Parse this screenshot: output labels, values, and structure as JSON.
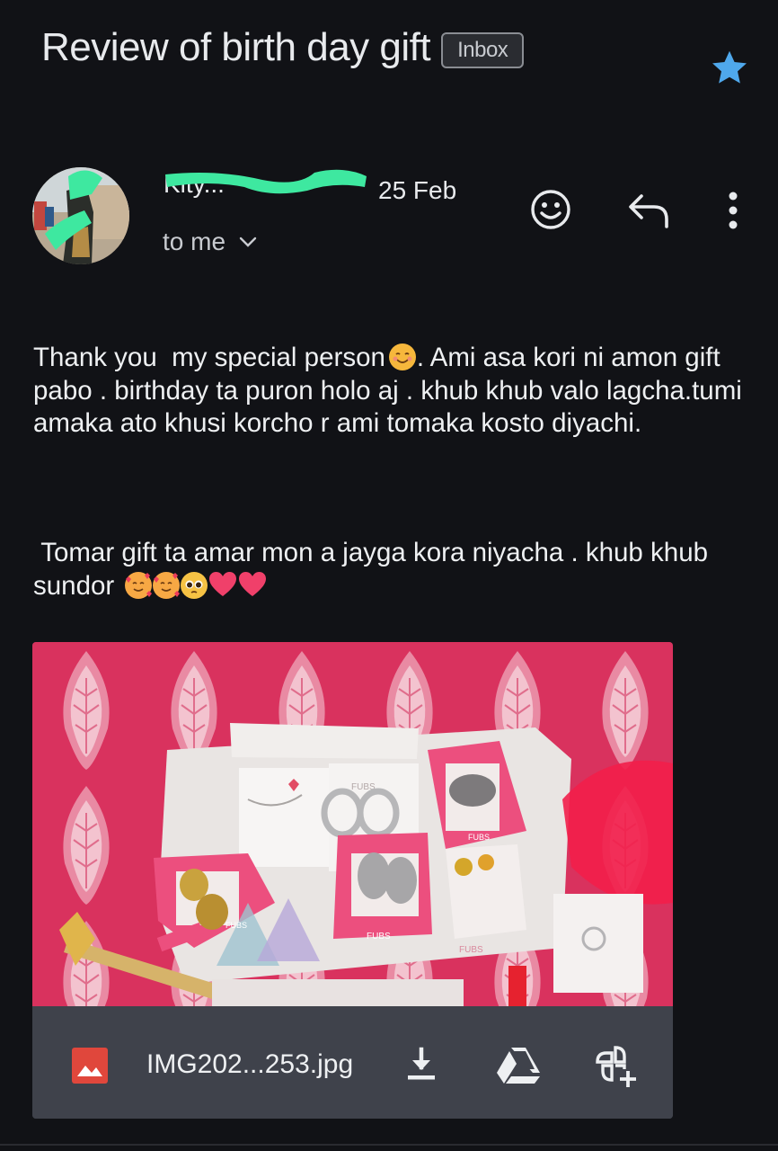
{
  "email": {
    "subject": "Review of birth day gift",
    "label": "Inbox",
    "starred": true,
    "sender_name": "Kity...",
    "date": "25 Feb",
    "recipient": "to me"
  },
  "body": {
    "paragraph1": "Thank you  my special person",
    "paragraph1_rest": ". Ami asa kori ni amon gift pabo . birthday ta puron holo aj . khub khub valo lagcha.tumi amaka ato khusi korcho r ami tomaka kosto diyachi.",
    "paragraph2": " Tomar gift ta amar mon a jayga kora niyacha . khub khub sundor "
  },
  "attachment": {
    "file_name": "IMG202...253.jpg",
    "image_labels": [
      "FUBS",
      "FUBS",
      "FUBS",
      "FUBS",
      "FUBS"
    ]
  },
  "icons": {
    "star": "star-icon",
    "emoji_reaction": "add-reaction-icon",
    "reply": "reply-icon",
    "more": "more-vert-icon",
    "image_file": "image-file-icon",
    "download": "download-icon",
    "drive": "google-drive-icon",
    "photos": "add-to-photos-icon"
  },
  "colors": {
    "background": "#111216",
    "star": "#4fa8ec",
    "attachment_bar": "#3f424b",
    "image_icon": "#e0473c",
    "sender_redaction": "#3ee8a0"
  }
}
